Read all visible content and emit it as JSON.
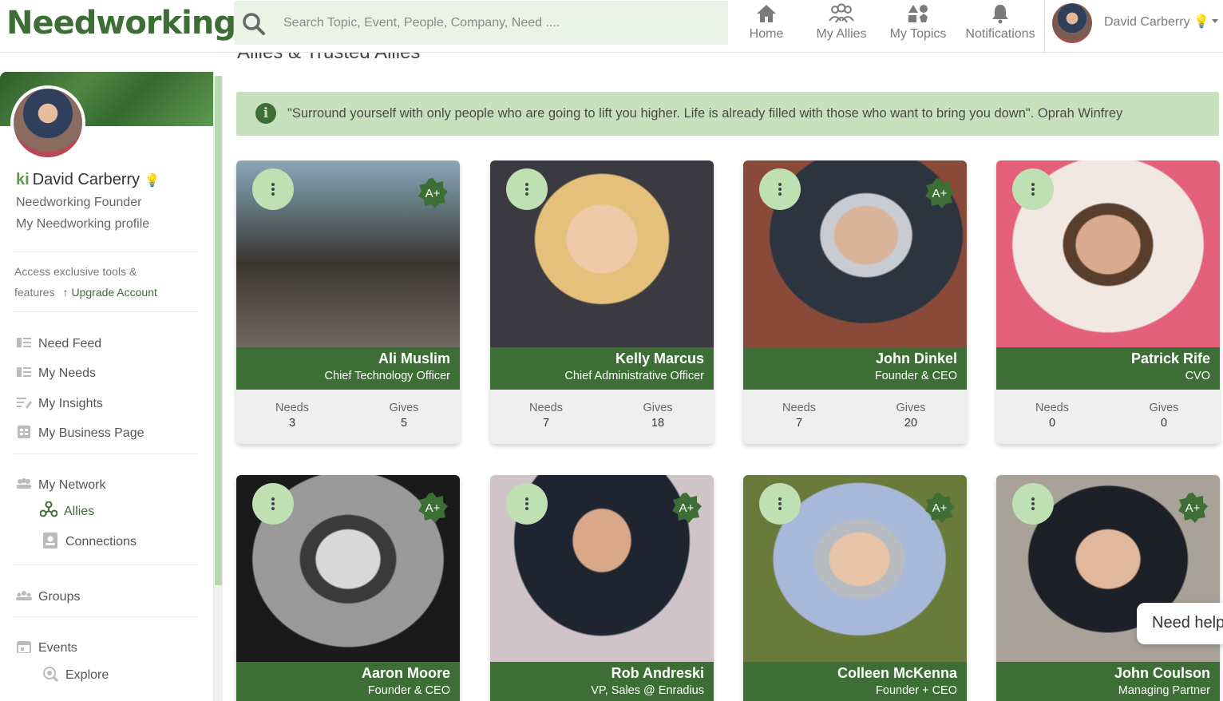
{
  "header": {
    "logo": "Needworking",
    "search_placeholder": "Search Topic, Event, People, Company, Need ....",
    "nav": [
      {
        "label": "Home",
        "icon": "home-icon"
      },
      {
        "label": "My Allies",
        "icon": "allies-icon"
      },
      {
        "label": "My Topics",
        "icon": "topics-icon"
      },
      {
        "label": "Notifications",
        "icon": "bell-icon"
      }
    ],
    "user_name": "David Carberry"
  },
  "sidebar": {
    "name": "David Carberry",
    "title": "Needworking Founder",
    "profile_link": "My Needworking profile",
    "promo_line1": "Access exclusive tools &",
    "promo_line2": "features",
    "upgrade_label": "Upgrade Account",
    "items": [
      {
        "label": "Need Feed"
      },
      {
        "label": "My Needs"
      },
      {
        "label": "My Insights"
      },
      {
        "label": "My Business Page"
      },
      {
        "label": "My Network"
      },
      {
        "label": "Allies"
      },
      {
        "label": "Connections"
      },
      {
        "label": "Groups"
      },
      {
        "label": "Events"
      },
      {
        "label": "Explore"
      }
    ]
  },
  "main": {
    "title": "Allies & Trusted Allies",
    "quote": "\"Surround yourself with only people who are going to lift you higher. Life is already filled with those who want to bring you down\". Oprah Winfrey",
    "stat_labels": {
      "needs": "Needs",
      "gives": "Gives"
    },
    "badge_text": "A+",
    "cards": [
      {
        "name": "Ali Muslim",
        "title": "Chief Technology Officer",
        "needs": "3",
        "gives": "5",
        "badge": true
      },
      {
        "name": "Kelly Marcus",
        "title": "Chief Administrative Officer",
        "needs": "7",
        "gives": "18",
        "badge": false
      },
      {
        "name": "John Dinkel",
        "title": "Founder & CEO",
        "needs": "7",
        "gives": "20",
        "badge": true
      },
      {
        "name": "Patrick Rife",
        "title": "CVO",
        "needs": "0",
        "gives": "0",
        "badge": false
      },
      {
        "name": "Aaron Moore",
        "title": "Founder & CEO",
        "badge": true
      },
      {
        "name": "Rob Andreski",
        "title": "VP, Sales @ Enradius",
        "badge": true
      },
      {
        "name": "Colleen McKenna",
        "title": "Founder + CEO",
        "badge": true
      },
      {
        "name": "John Coulson",
        "title": "Managing Partner",
        "badge": true
      }
    ]
  },
  "help_widget": "Need help?",
  "colors": {
    "brand_green": "#3d6e35",
    "light_green": "#c7e1bd",
    "search_bg": "#eaf3e5"
  }
}
